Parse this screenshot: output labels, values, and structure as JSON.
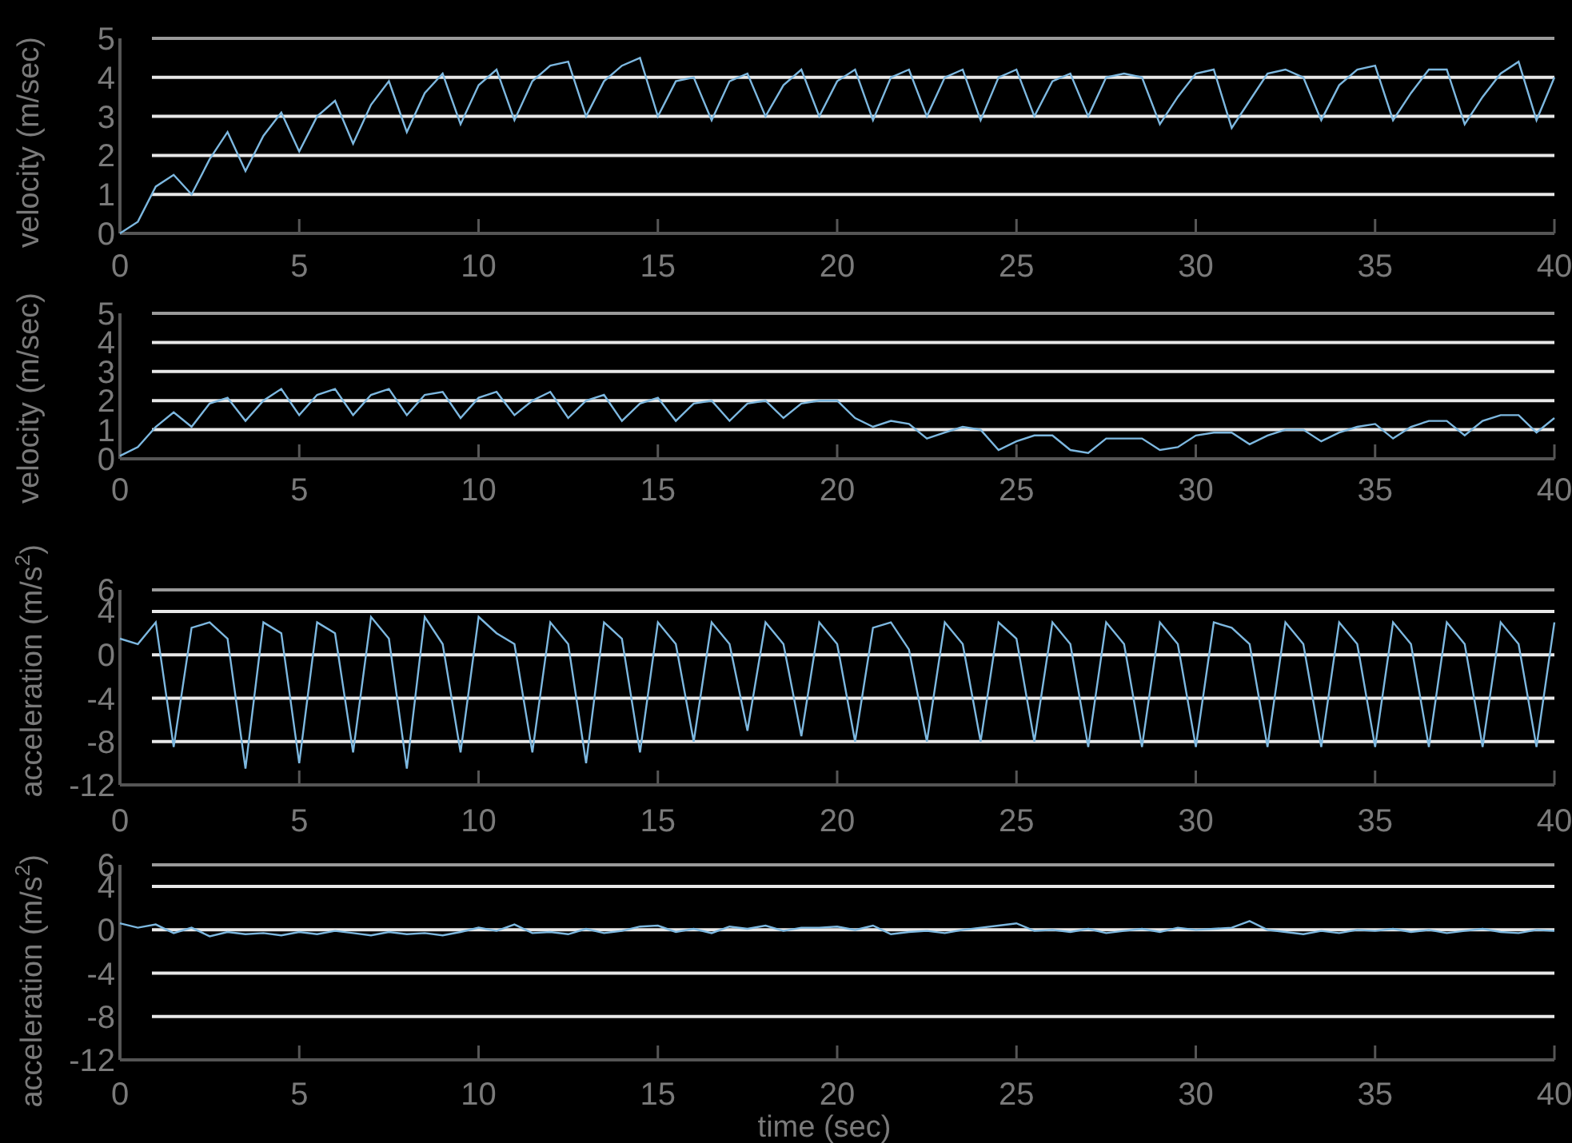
{
  "panels": [
    {
      "chart_data": {
        "type": "line",
        "ylabel": "velocity (m/sec)",
        "xlim": [
          0,
          40
        ],
        "ylim": [
          0,
          5
        ],
        "xticks": [
          0,
          5,
          10,
          15,
          20,
          25,
          30,
          35,
          40
        ],
        "yticks": [
          0,
          1,
          2,
          3,
          4,
          5
        ],
        "grid": true,
        "x": [
          0,
          0.5,
          1,
          1.5,
          2,
          2.5,
          3,
          3.5,
          4,
          4.5,
          5,
          5.5,
          6,
          6.5,
          7,
          7.5,
          8,
          8.5,
          9,
          9.5,
          10,
          10.5,
          11,
          11.5,
          12,
          12.5,
          13,
          13.5,
          14,
          14.5,
          15,
          15.5,
          16,
          16.5,
          17,
          17.5,
          18,
          18.5,
          19,
          19.5,
          20,
          20.5,
          21,
          21.5,
          22,
          22.5,
          23,
          23.5,
          24,
          24.5,
          25,
          25.5,
          26,
          26.5,
          27,
          27.5,
          28,
          28.5,
          29,
          29.5,
          30,
          30.5,
          31,
          31.5,
          32,
          32.5,
          33,
          33.5,
          34,
          34.5,
          35,
          35.5,
          36,
          36.5,
          37,
          37.5,
          38,
          38.5,
          39,
          39.5,
          40
        ],
        "series": [
          {
            "color": "#7db8e0",
            "values": [
              0,
              0.3,
              1.2,
              1.5,
              1.0,
              1.9,
              2.6,
              1.6,
              2.5,
              3.1,
              2.1,
              3.0,
              3.4,
              2.3,
              3.3,
              3.9,
              2.6,
              3.6,
              4.1,
              2.8,
              3.8,
              4.2,
              2.9,
              3.9,
              4.3,
              4.4,
              3.0,
              3.9,
              4.3,
              4.5,
              3.0,
              3.9,
              4.0,
              2.9,
              3.9,
              4.1,
              3.0,
              3.8,
              4.2,
              3.0,
              3.9,
              4.2,
              2.9,
              4.0,
              4.2,
              3.0,
              4.0,
              4.2,
              2.9,
              4.0,
              4.2,
              3.0,
              3.9,
              4.1,
              3.0,
              4.0,
              4.1,
              4.0,
              2.8,
              3.5,
              4.1,
              4.2,
              2.7,
              3.4,
              4.1,
              4.2,
              4.0,
              2.9,
              3.8,
              4.2,
              4.3,
              2.9,
              3.6,
              4.2,
              4.2,
              2.8,
              3.5,
              4.1,
              4.4,
              2.9,
              4.0
            ]
          }
        ]
      }
    },
    {
      "chart_data": {
        "type": "line",
        "ylabel": "velocity (m/sec)",
        "xlim": [
          0,
          40
        ],
        "ylim": [
          0,
          5
        ],
        "xticks": [
          0,
          5,
          10,
          15,
          20,
          25,
          30,
          35,
          40
        ],
        "yticks": [
          0,
          1,
          2,
          3,
          4,
          5
        ],
        "grid": true,
        "x": [
          0,
          0.5,
          1,
          1.5,
          2,
          2.5,
          3,
          3.5,
          4,
          4.5,
          5,
          5.5,
          6,
          6.5,
          7,
          7.5,
          8,
          8.5,
          9,
          9.5,
          10,
          10.5,
          11,
          11.5,
          12,
          12.5,
          13,
          13.5,
          14,
          14.5,
          15,
          15.5,
          16,
          16.5,
          17,
          17.5,
          18,
          18.5,
          19,
          19.5,
          20,
          20.5,
          21,
          21.5,
          22,
          22.5,
          23,
          23.5,
          24,
          24.5,
          25,
          25.5,
          26,
          26.5,
          27,
          27.5,
          28,
          28.5,
          29,
          29.5,
          30,
          30.5,
          31,
          31.5,
          32,
          32.5,
          33,
          33.5,
          34,
          34.5,
          35,
          35.5,
          36,
          36.5,
          37,
          37.5,
          38,
          38.5,
          39,
          39.5,
          40
        ],
        "series": [
          {
            "color": "#7db8e0",
            "values": [
              0.1,
              0.4,
              1.1,
              1.6,
              1.1,
              1.9,
              2.1,
              1.3,
              2.0,
              2.4,
              1.5,
              2.2,
              2.4,
              1.5,
              2.2,
              2.4,
              1.5,
              2.2,
              2.3,
              1.4,
              2.1,
              2.3,
              1.5,
              2.0,
              2.3,
              1.4,
              2.0,
              2.2,
              1.3,
              1.9,
              2.1,
              1.3,
              1.9,
              2.0,
              1.3,
              1.9,
              2.0,
              1.4,
              1.9,
              2.0,
              2.0,
              1.4,
              1.1,
              1.3,
              1.2,
              0.7,
              0.9,
              1.1,
              1.0,
              0.3,
              0.6,
              0.8,
              0.8,
              0.3,
              0.2,
              0.7,
              0.7,
              0.7,
              0.3,
              0.4,
              0.8,
              0.9,
              0.9,
              0.5,
              0.8,
              1.0,
              1.0,
              0.6,
              0.9,
              1.1,
              1.2,
              0.7,
              1.1,
              1.3,
              1.3,
              0.8,
              1.3,
              1.5,
              1.5,
              0.9,
              1.4
            ]
          }
        ]
      }
    },
    {
      "chart_data": {
        "type": "line",
        "ylabel": "acceleration (m/s$^{2}$)",
        "xlim": [
          0,
          40
        ],
        "ylim": [
          -12,
          6
        ],
        "xticks": [
          0,
          5,
          10,
          15,
          20,
          25,
          30,
          35,
          40
        ],
        "yticks": [
          -12,
          -8,
          -4,
          0,
          4,
          6
        ],
        "grid": true,
        "x": [
          0,
          0.5,
          1,
          1.5,
          2,
          2.5,
          3,
          3.5,
          4,
          4.5,
          5,
          5.5,
          6,
          6.5,
          7,
          7.5,
          8,
          8.5,
          9,
          9.5,
          10,
          10.5,
          11,
          11.5,
          12,
          12.5,
          13,
          13.5,
          14,
          14.5,
          15,
          15.5,
          16,
          16.5,
          17,
          17.5,
          18,
          18.5,
          19,
          19.5,
          20,
          20.5,
          21,
          21.5,
          22,
          22.5,
          23,
          23.5,
          24,
          24.5,
          25,
          25.5,
          26,
          26.5,
          27,
          27.5,
          28,
          28.5,
          29,
          29.5,
          30,
          30.5,
          31,
          31.5,
          32,
          32.5,
          33,
          33.5,
          34,
          34.5,
          35,
          35.5,
          36,
          36.5,
          37,
          37.5,
          38,
          38.5,
          39,
          39.5,
          40
        ],
        "series": [
          {
            "color": "#7db8e0",
            "values": [
              1.5,
              1.0,
              3.0,
              -8.5,
              2.5,
              3.0,
              1.5,
              -10.5,
              3.0,
              2.0,
              -10,
              3.0,
              2.0,
              -9,
              3.5,
              1.5,
              -10.5,
              3.5,
              1.0,
              -9,
              3.5,
              2.0,
              1.0,
              -9,
              3.0,
              1.0,
              -10,
              3.0,
              1.5,
              -9,
              3.0,
              1.0,
              -8,
              3.0,
              1.0,
              -7,
              3.0,
              1.0,
              -7.5,
              3.0,
              1.0,
              -8,
              2.5,
              3.0,
              0.5,
              -8,
              3.0,
              1.0,
              -8,
              3.0,
              1.5,
              -8,
              3.0,
              1.0,
              -8.5,
              3.0,
              1.0,
              -8.5,
              3.0,
              1.0,
              -8.5,
              3.0,
              2.5,
              1.0,
              -8.5,
              3.0,
              1.0,
              -8.5,
              3.0,
              1.0,
              -8.5,
              3.0,
              1.0,
              -8.5,
              3.0,
              1.0,
              -8.5,
              3.0,
              1.0,
              -8.5,
              3.0
            ]
          }
        ]
      }
    },
    {
      "chart_data": {
        "type": "line",
        "ylabel": "acceleration (m/s$^{2}$)",
        "xlabel": "time (sec)",
        "xlim": [
          0,
          40
        ],
        "ylim": [
          -12,
          6
        ],
        "xticks": [
          0,
          5,
          10,
          15,
          20,
          25,
          30,
          35,
          40
        ],
        "yticks": [
          -12,
          -8,
          -4,
          0,
          4,
          6
        ],
        "grid": true,
        "x": [
          0,
          0.5,
          1,
          1.5,
          2,
          2.5,
          3,
          3.5,
          4,
          4.5,
          5,
          5.5,
          6,
          6.5,
          7,
          7.5,
          8,
          8.5,
          9,
          9.5,
          10,
          10.5,
          11,
          11.5,
          12,
          12.5,
          13,
          13.5,
          14,
          14.5,
          15,
          15.5,
          16,
          16.5,
          17,
          17.5,
          18,
          18.5,
          19,
          19.5,
          20,
          20.5,
          21,
          21.5,
          22,
          22.5,
          23,
          23.5,
          24,
          24.5,
          25,
          25.5,
          26,
          26.5,
          27,
          27.5,
          28,
          28.5,
          29,
          29.5,
          30,
          30.5,
          31,
          31.5,
          32,
          32.5,
          33,
          33.5,
          34,
          34.5,
          35,
          35.5,
          36,
          36.5,
          37,
          37.5,
          38,
          38.5,
          39,
          39.5,
          40
        ],
        "series": [
          {
            "color": "#7db8e0",
            "values": [
              0.6,
              0.2,
              0.5,
              -0.3,
              0.2,
              -0.6,
              -0.2,
              -0.4,
              -0.3,
              -0.5,
              -0.2,
              -0.4,
              -0.1,
              -0.3,
              -0.5,
              -0.2,
              -0.4,
              -0.3,
              -0.5,
              -0.2,
              0.2,
              -0.1,
              0.5,
              -0.3,
              -0.2,
              -0.4,
              0.1,
              -0.3,
              -0.1,
              0.3,
              0.4,
              -0.2,
              0.1,
              -0.3,
              0.3,
              0.1,
              0.4,
              -0.1,
              0.2,
              0.2,
              0.3,
              0.0,
              0.4,
              -0.4,
              -0.2,
              -0.1,
              -0.3,
              0.0,
              0.2,
              0.4,
              0.6,
              -0.1,
              0.0,
              -0.2,
              0.1,
              -0.3,
              -0.1,
              0.1,
              -0.2,
              0.2,
              0.0,
              0.1,
              0.2,
              0.8,
              0.0,
              -0.2,
              -0.4,
              -0.1,
              -0.3,
              0.0,
              -0.1,
              0.1,
              -0.2,
              0.0,
              -0.3,
              -0.1,
              0.1,
              -0.2,
              -0.3,
              0.0,
              -0.1
            ]
          }
        ]
      }
    }
  ]
}
